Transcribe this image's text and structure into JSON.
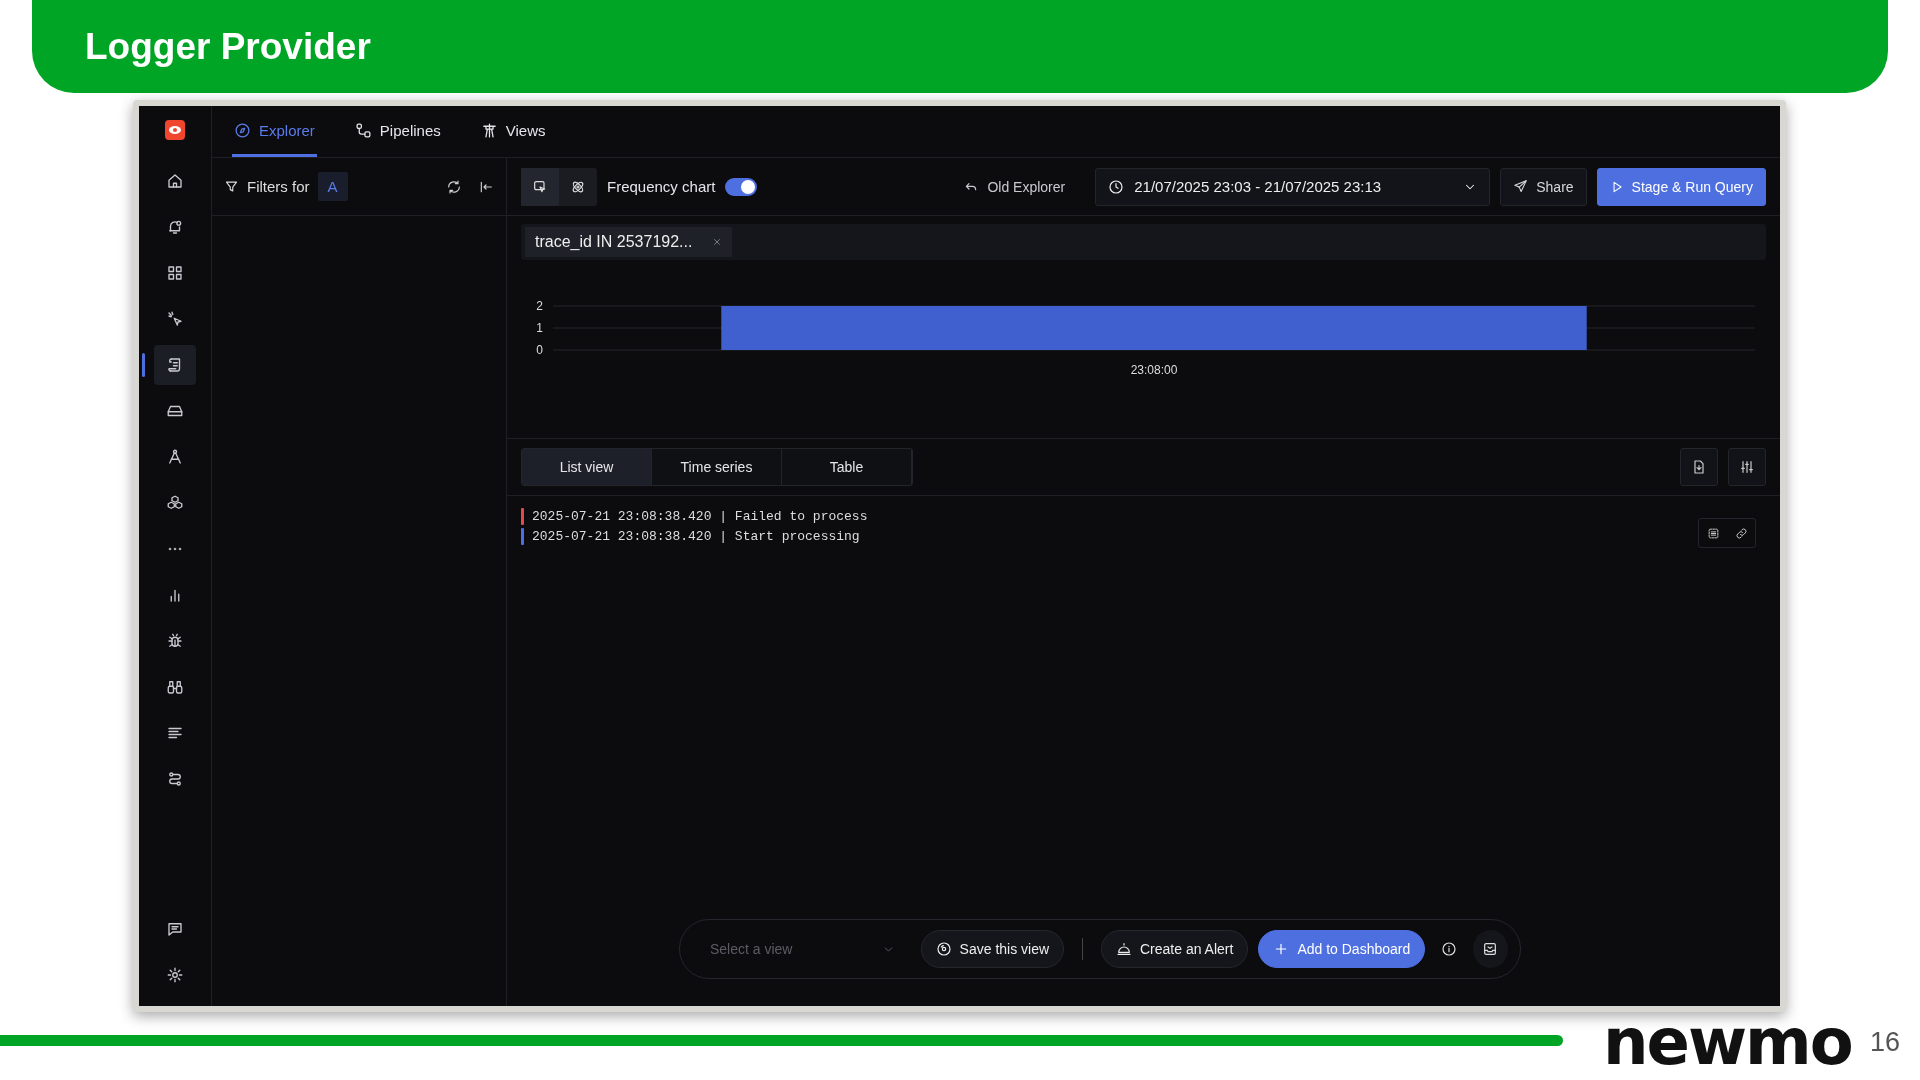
{
  "slide": {
    "title": "Logger Provider",
    "logo": "newmo",
    "page_number": "16"
  },
  "sidebar": {
    "items": [
      {
        "selected": false
      },
      {
        "selected": false
      },
      {
        "selected": false
      },
      {
        "selected": false
      },
      {
        "selected": true
      },
      {
        "selected": false
      },
      {
        "selected": false
      },
      {
        "selected": false
      },
      {
        "selected": false
      },
      {
        "selected": false
      },
      {
        "selected": false
      },
      {
        "selected": false
      },
      {
        "selected": false
      },
      {
        "selected": false
      },
      {
        "selected": false
      },
      {
        "selected": false
      }
    ]
  },
  "tabs": [
    {
      "label": "Explorer",
      "selected": true
    },
    {
      "label": "Pipelines",
      "selected": false
    },
    {
      "label": "Views",
      "selected": false
    }
  ],
  "filters": {
    "label": "Filters for",
    "query": "A"
  },
  "toolbar": {
    "frequency_chart": {
      "label": "Frequency chart",
      "on": true
    },
    "old_explorer": "Old Explorer",
    "time_range": "21/07/2025 23:03 - 21/07/2025 23:13",
    "share": "Share",
    "run": "Stage & Run Query"
  },
  "filter_chip": "trace_id IN 2537192...",
  "chart": {
    "chart_data": {
      "type": "bar",
      "categories": [
        "23:08:00"
      ],
      "values": [
        2
      ],
      "yticks": [
        0,
        1,
        2
      ],
      "ylim": [
        0,
        2
      ]
    }
  },
  "view_tabs": [
    {
      "label": "List view",
      "selected": true
    },
    {
      "label": "Time series",
      "selected": false
    },
    {
      "label": "Table",
      "selected": false
    }
  ],
  "logs": [
    {
      "text": "2025-07-21 23:08:38.420 | Failed to process",
      "color": "#e5484d"
    },
    {
      "text": "2025-07-21 23:08:38.420 | Start processing",
      "color": "#4e6fe0"
    }
  ],
  "bottom_bar": {
    "select_placeholder": "Select a view",
    "save": "Save this view",
    "alert": "Create an Alert",
    "dashboard": "Add to Dashboard"
  }
}
